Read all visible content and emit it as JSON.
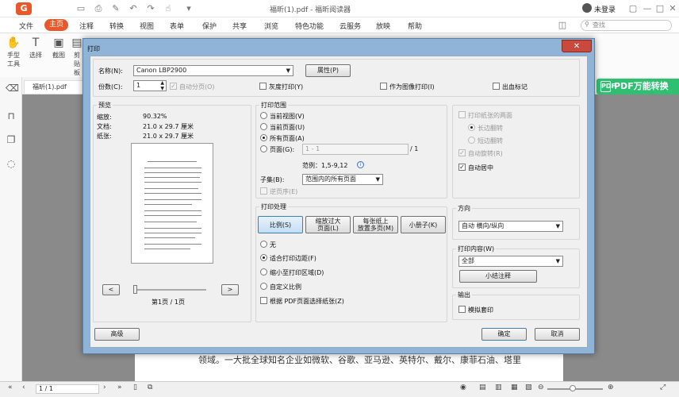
{
  "app": {
    "window_title": "福昕(1).pdf - 福昕阅读器",
    "login": "未登录",
    "logo": "G"
  },
  "menu": [
    "文件",
    "主页",
    "注释",
    "转换",
    "视图",
    "表单",
    "保护",
    "共享",
    "浏览",
    "特色功能",
    "云服务",
    "放映",
    "帮助"
  ],
  "search_placeholder": "查找",
  "tools": [
    "手型\n工具",
    "选择",
    "截图",
    "剪贴板"
  ],
  "tab": {
    "name": "福昕(1).pdf"
  },
  "pdf_badge": {
    "label": "PDF万能转换",
    "icon": "PDF"
  },
  "page_text": "领域。一大批全球知名企业如微软、谷歌、亚马逊、英特尔、戴尔、康菲石油、塔里",
  "statusbar": {
    "page": "1 / 1"
  },
  "dialog": {
    "title": "打印",
    "close": "✕",
    "printer_label": "名称(N):",
    "printer_value": "Canon LBP2900",
    "properties_btn": "属性(P)",
    "copies_label": "份数(C):",
    "copies_value": "1",
    "collate": "自动分页(O)",
    "grayscale": "灰度打印(Y)",
    "print_as_image": "作为图像打印(I)",
    "bleed": "出血标记",
    "preview": {
      "title": "预览",
      "zoom_label": "缩放:",
      "zoom_value": "90.32%",
      "doc_label": "文档:",
      "doc_value": "21.0 x 29.7 厘米",
      "paper_label": "纸张:",
      "paper_value": "21.0 x 29.7 厘米",
      "prev": "<",
      "next": ">",
      "page_indicator": "第1页 / 1页"
    },
    "range": {
      "title": "打印范围",
      "current_view": "当前视图(V)",
      "current_page": "当前页面(U)",
      "all_pages": "所有页面(A)",
      "pages": "页面(G):",
      "pages_value": "1 - 1",
      "pages_total": "/ 1",
      "example": "范例：1,5-9,12",
      "subset_label": "子集(B):",
      "subset_value": "范围内的所有页面",
      "reverse": "逆页序(E)"
    },
    "duplex": {
      "both_sides": "打印纸张的两面",
      "long_edge": "长边翻转",
      "short_edge": "短边翻转",
      "auto_rotate": "自动旋转(R)",
      "auto_center": "自动居中"
    },
    "handling": {
      "title": "打印处理",
      "btn_scale": "比例(S)",
      "btn_fit": "缩放过大\n页面(L)",
      "btn_multi": "每张纸上\n放置多页(M)",
      "btn_booklet": "小册子(K)",
      "none": "无",
      "fit_margins": "适合打印边距(F)",
      "shrink": "缩小至打印区域(D)",
      "custom": "自定义比例",
      "by_pdf_size": "根据 PDF页面选择纸张(Z)"
    },
    "orientation": {
      "title": "方向",
      "value": "自动 横向/纵向"
    },
    "content": {
      "title": "打印内容(W)",
      "value": "全部",
      "summary_btn": "小结注释"
    },
    "output": {
      "title": "输出",
      "simulate": "模拟套印"
    },
    "advanced_btn": "高级",
    "ok_btn": "确定",
    "cancel_btn": "取消"
  }
}
